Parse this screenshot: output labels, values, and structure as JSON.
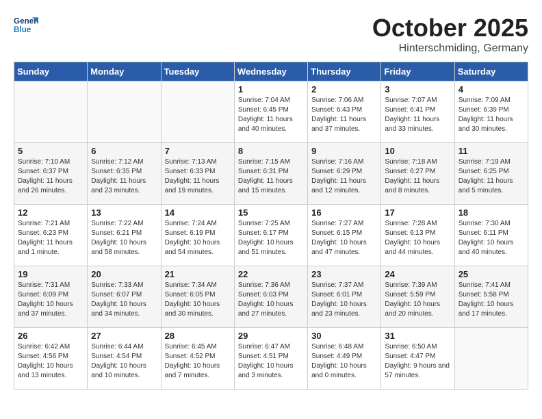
{
  "header": {
    "logo_line1": "General",
    "logo_line2": "Blue",
    "month": "October 2025",
    "location": "Hinterschmiding, Germany"
  },
  "weekdays": [
    "Sunday",
    "Monday",
    "Tuesday",
    "Wednesday",
    "Thursday",
    "Friday",
    "Saturday"
  ],
  "weeks": [
    [
      {
        "day": "",
        "info": ""
      },
      {
        "day": "",
        "info": ""
      },
      {
        "day": "",
        "info": ""
      },
      {
        "day": "1",
        "info": "Sunrise: 7:04 AM\nSunset: 6:45 PM\nDaylight: 11 hours and 40 minutes."
      },
      {
        "day": "2",
        "info": "Sunrise: 7:06 AM\nSunset: 6:43 PM\nDaylight: 11 hours and 37 minutes."
      },
      {
        "day": "3",
        "info": "Sunrise: 7:07 AM\nSunset: 6:41 PM\nDaylight: 11 hours and 33 minutes."
      },
      {
        "day": "4",
        "info": "Sunrise: 7:09 AM\nSunset: 6:39 PM\nDaylight: 11 hours and 30 minutes."
      }
    ],
    [
      {
        "day": "5",
        "info": "Sunrise: 7:10 AM\nSunset: 6:37 PM\nDaylight: 11 hours and 26 minutes."
      },
      {
        "day": "6",
        "info": "Sunrise: 7:12 AM\nSunset: 6:35 PM\nDaylight: 11 hours and 23 minutes."
      },
      {
        "day": "7",
        "info": "Sunrise: 7:13 AM\nSunset: 6:33 PM\nDaylight: 11 hours and 19 minutes."
      },
      {
        "day": "8",
        "info": "Sunrise: 7:15 AM\nSunset: 6:31 PM\nDaylight: 11 hours and 15 minutes."
      },
      {
        "day": "9",
        "info": "Sunrise: 7:16 AM\nSunset: 6:29 PM\nDaylight: 11 hours and 12 minutes."
      },
      {
        "day": "10",
        "info": "Sunrise: 7:18 AM\nSunset: 6:27 PM\nDaylight: 11 hours and 8 minutes."
      },
      {
        "day": "11",
        "info": "Sunrise: 7:19 AM\nSunset: 6:25 PM\nDaylight: 11 hours and 5 minutes."
      }
    ],
    [
      {
        "day": "12",
        "info": "Sunrise: 7:21 AM\nSunset: 6:23 PM\nDaylight: 11 hours and 1 minute."
      },
      {
        "day": "13",
        "info": "Sunrise: 7:22 AM\nSunset: 6:21 PM\nDaylight: 10 hours and 58 minutes."
      },
      {
        "day": "14",
        "info": "Sunrise: 7:24 AM\nSunset: 6:19 PM\nDaylight: 10 hours and 54 minutes."
      },
      {
        "day": "15",
        "info": "Sunrise: 7:25 AM\nSunset: 6:17 PM\nDaylight: 10 hours and 51 minutes."
      },
      {
        "day": "16",
        "info": "Sunrise: 7:27 AM\nSunset: 6:15 PM\nDaylight: 10 hours and 47 minutes."
      },
      {
        "day": "17",
        "info": "Sunrise: 7:28 AM\nSunset: 6:13 PM\nDaylight: 10 hours and 44 minutes."
      },
      {
        "day": "18",
        "info": "Sunrise: 7:30 AM\nSunset: 6:11 PM\nDaylight: 10 hours and 40 minutes."
      }
    ],
    [
      {
        "day": "19",
        "info": "Sunrise: 7:31 AM\nSunset: 6:09 PM\nDaylight: 10 hours and 37 minutes."
      },
      {
        "day": "20",
        "info": "Sunrise: 7:33 AM\nSunset: 6:07 PM\nDaylight: 10 hours and 34 minutes."
      },
      {
        "day": "21",
        "info": "Sunrise: 7:34 AM\nSunset: 6:05 PM\nDaylight: 10 hours and 30 minutes."
      },
      {
        "day": "22",
        "info": "Sunrise: 7:36 AM\nSunset: 6:03 PM\nDaylight: 10 hours and 27 minutes."
      },
      {
        "day": "23",
        "info": "Sunrise: 7:37 AM\nSunset: 6:01 PM\nDaylight: 10 hours and 23 minutes."
      },
      {
        "day": "24",
        "info": "Sunrise: 7:39 AM\nSunset: 5:59 PM\nDaylight: 10 hours and 20 minutes."
      },
      {
        "day": "25",
        "info": "Sunrise: 7:41 AM\nSunset: 5:58 PM\nDaylight: 10 hours and 17 minutes."
      }
    ],
    [
      {
        "day": "26",
        "info": "Sunrise: 6:42 AM\nSunset: 4:56 PM\nDaylight: 10 hours and 13 minutes."
      },
      {
        "day": "27",
        "info": "Sunrise: 6:44 AM\nSunset: 4:54 PM\nDaylight: 10 hours and 10 minutes."
      },
      {
        "day": "28",
        "info": "Sunrise: 6:45 AM\nSunset: 4:52 PM\nDaylight: 10 hours and 7 minutes."
      },
      {
        "day": "29",
        "info": "Sunrise: 6:47 AM\nSunset: 4:51 PM\nDaylight: 10 hours and 3 minutes."
      },
      {
        "day": "30",
        "info": "Sunrise: 6:48 AM\nSunset: 4:49 PM\nDaylight: 10 hours and 0 minutes."
      },
      {
        "day": "31",
        "info": "Sunrise: 6:50 AM\nSunset: 4:47 PM\nDaylight: 9 hours and 57 minutes."
      },
      {
        "day": "",
        "info": ""
      }
    ]
  ]
}
